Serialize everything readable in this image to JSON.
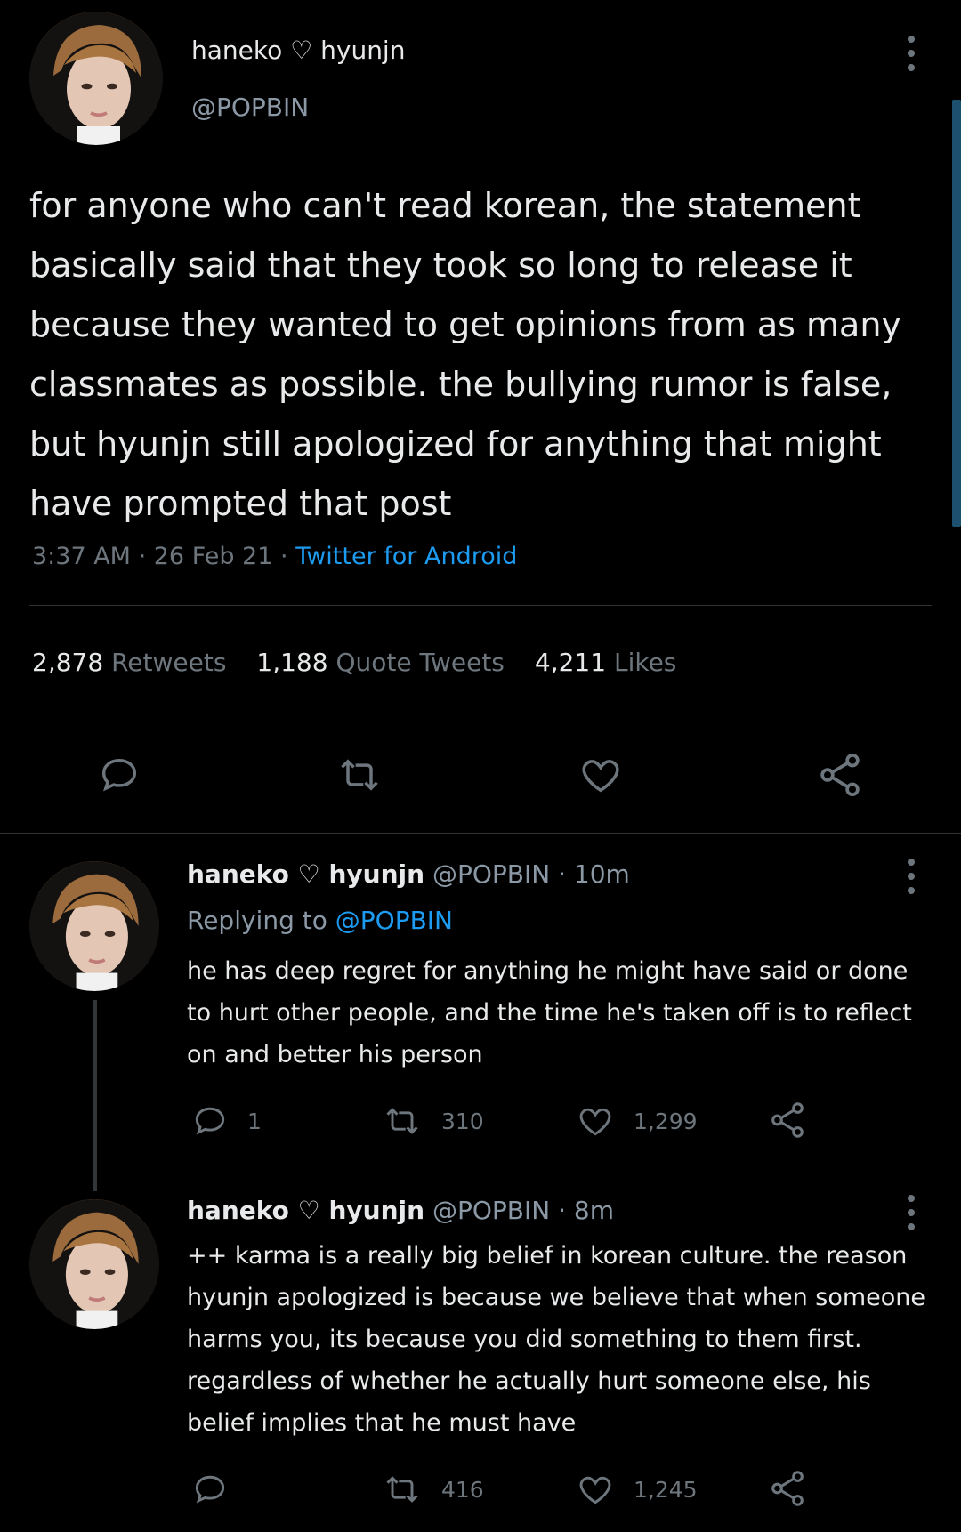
{
  "tweet": {
    "display_name": "haneko ♡ hyunjn",
    "handle": "@POPBIN",
    "text": "for anyone who can't read korean, the statement basically said that they took so long to release it because they wanted to get opinions from as many classmates as possible. the bullying rumor is false, but hyunjn still apologized for anything that might have prompted that post",
    "time": "3:37 AM",
    "date": "26 Feb 21",
    "source": "Twitter for Android",
    "retweets_count": "2,878",
    "retweets_label": "Retweets",
    "quotes_count": "1,188",
    "quotes_label": "Quote Tweets",
    "likes_count": "4,211",
    "likes_label": "Likes"
  },
  "replies": [
    {
      "display_name": "haneko ♡ hyunjn",
      "handle": "@POPBIN",
      "age": "10m",
      "replying_prefix": "Replying to",
      "replying_to": "@POPBIN",
      "text": "he has deep regret for anything he might have said or done to hurt other people, and the time he's taken off is to reflect on and better his person",
      "reply_count": "1",
      "retweet_count": "310",
      "like_count": "1,299"
    },
    {
      "display_name": "haneko ♡ hyunjn",
      "handle": "@POPBIN",
      "age": "8m",
      "text": "++ karma is a really big belief in korean culture. the reason hyunjn apologized is because we believe that when someone harms you, its because you did something to them first. regardless of whether he actually hurt someone else, his belief implies that he must have",
      "reply_count": "",
      "retweet_count": "416",
      "like_count": "1,245"
    }
  ],
  "colors": {
    "background": "#000000",
    "text": "#e7e9ea",
    "muted": "#6e767d",
    "link": "#1d9bf0"
  }
}
